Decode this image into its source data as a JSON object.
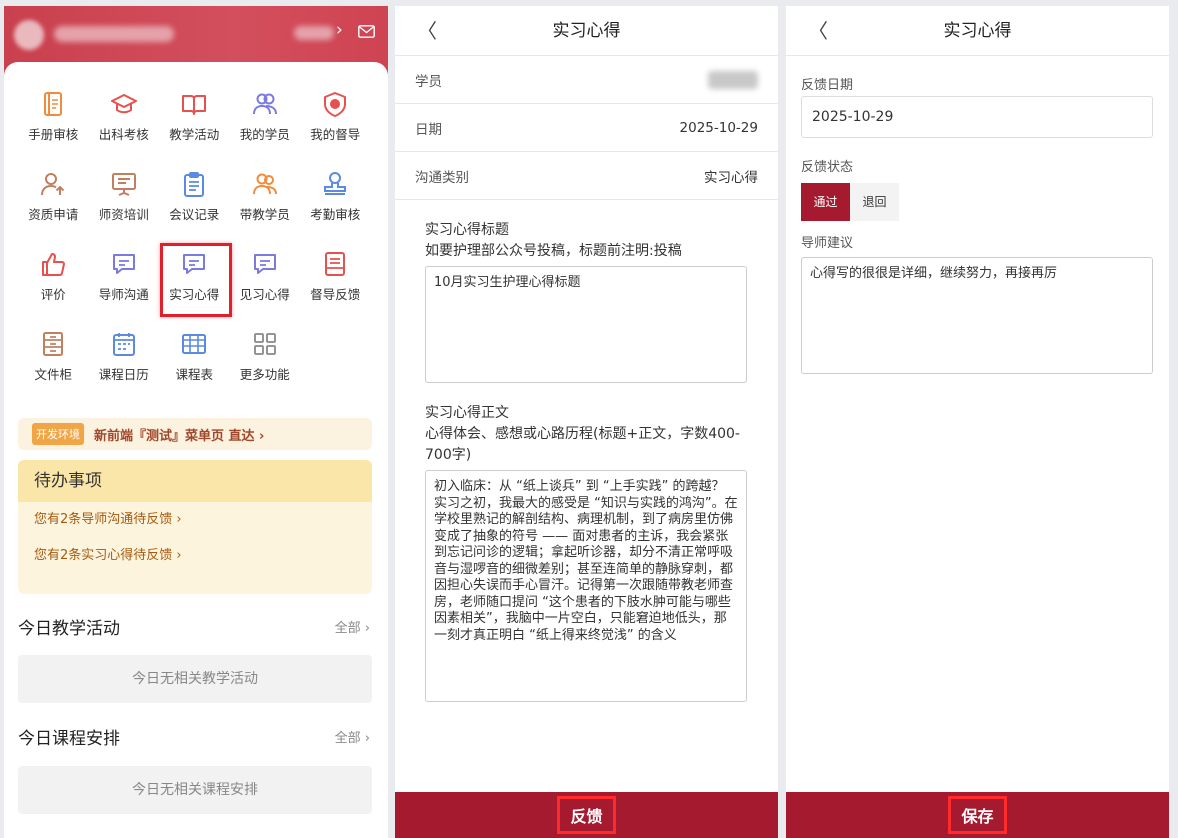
{
  "home": {
    "grid": [
      {
        "label": "手册审核",
        "icon": "handbook-icon",
        "color": "#f08c3a"
      },
      {
        "label": "出科考核",
        "icon": "graduation-cap-icon",
        "color": "#e8504e"
      },
      {
        "label": "教学活动",
        "icon": "open-book-icon",
        "color": "#e8504e"
      },
      {
        "label": "我的学员",
        "icon": "students-icon",
        "color": "#7a7ae0"
      },
      {
        "label": "我的督导",
        "icon": "shield-icon",
        "color": "#e8504e"
      },
      {
        "label": "资质申请",
        "icon": "user-upload-icon",
        "color": "#c08060"
      },
      {
        "label": "师资培训",
        "icon": "presentation-board-icon",
        "color": "#c08060"
      },
      {
        "label": "会议记录",
        "icon": "clipboard-icon",
        "color": "#5a8be0"
      },
      {
        "label": "带教学员",
        "icon": "teaching-students-icon",
        "color": "#f08c3a"
      },
      {
        "label": "考勤审核",
        "icon": "stamp-icon",
        "color": "#5a8be0"
      },
      {
        "label": "评价",
        "icon": "thumbs-up-icon",
        "color": "#e8504e"
      },
      {
        "label": "导师沟通",
        "icon": "chat-bubble-icon",
        "color": "#7a7ae0"
      },
      {
        "label": "实习心得",
        "icon": "chat-bubble-icon",
        "color": "#7a7ae0"
      },
      {
        "label": "见习心得",
        "icon": "chat-bubble-icon",
        "color": "#7a7ae0"
      },
      {
        "label": "督导反馈",
        "icon": "feedback-form-icon",
        "color": "#e8504e"
      },
      {
        "label": "文件柜",
        "icon": "file-cabinet-icon",
        "color": "#c08060"
      },
      {
        "label": "课程日历",
        "icon": "calendar-icon",
        "color": "#5a8be0"
      },
      {
        "label": "课程表",
        "icon": "timetable-icon",
        "color": "#5a8be0"
      },
      {
        "label": "更多功能",
        "icon": "apps-grid-icon",
        "color": "#888888"
      }
    ],
    "dev_tag": "开发环境",
    "dev_text": "新前端『测试』菜单页 直达 ›",
    "todo_title": "待办事项",
    "todo_items": [
      "您有2条导师沟通待反馈 ›",
      "您有2条实习心得待反馈 ›"
    ],
    "activity_title": "今日教学活动",
    "activity_all": "全部 ›",
    "activity_empty": "今日无相关教学活动",
    "course_title": "今日课程安排",
    "course_all": "全部 ›",
    "course_empty": "今日无相关课程安排"
  },
  "detail": {
    "title": "实习心得",
    "back": "〈",
    "student_label": "学员",
    "date_label": "日期",
    "date_value": "2025-10-29",
    "type_label": "沟通类别",
    "type_value": "实习心得",
    "essay_title_label": "实习心得标题",
    "essay_title_hint": "如要护理部公众号投稿，标题前注明:投稿",
    "essay_title_value": "10月实习生护理心得标题",
    "essay_body_label": "实习心得正文",
    "essay_body_hint": "心得体会、感想或心路历程(标题+正文，字数400-700字)",
    "essay_body_value": "初入临床：从 “纸上谈兵” 到 “上手实践” 的跨越？\n实习之初，我最大的感受是 “知识与实践的鸿沟”。在学校里熟记的解剖结构、病理机制，到了病房里仿佛变成了抽象的符号 —— 面对患者的主诉，我会紧张到忘记问诊的逻辑；拿起听诊器，却分不清正常呼吸音与湿啰音的细微差别；甚至连简单的静脉穿刺，都因担心失误而手心冒汗。记得第一次跟随带教老师查房，老师随口提问 “这个患者的下肢水肿可能与哪些因素相关”，我脑中一片空白，只能窘迫地低头，那一刻才真正明白 “纸上得来终觉浅” 的含义",
    "feedback_button": "反馈"
  },
  "feedback": {
    "title": "实习心得",
    "back": "〈",
    "date_label": "反馈日期",
    "date_value": "2025-10-29",
    "status_label": "反馈状态",
    "status_pass": "通过",
    "status_return": "退回",
    "advice_label": "导师建议",
    "advice_value": "心得写的很很是详细，继续努力，再接再厉",
    "save_button": "保存"
  }
}
